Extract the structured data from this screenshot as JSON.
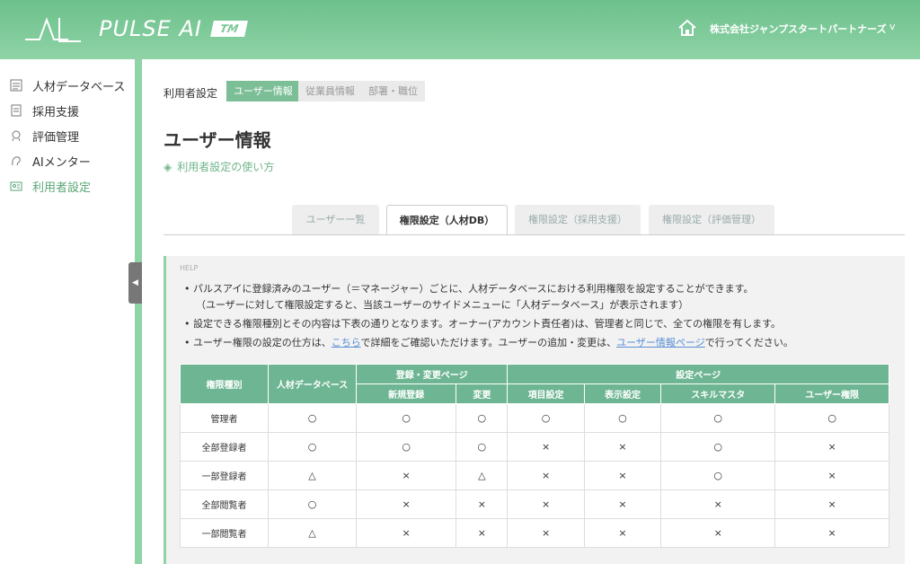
{
  "header": {
    "brand": "PULSE AI",
    "brand_tm": "TM",
    "company": "株式会社ジャンプスタートパートナーズ",
    "company_chevron": "v"
  },
  "sidebar": {
    "items": [
      {
        "label": "人材データベース",
        "icon": "database-icon"
      },
      {
        "label": "採用支援",
        "icon": "document-icon"
      },
      {
        "label": "評価管理",
        "icon": "medal-icon"
      },
      {
        "label": "AIメンター",
        "icon": "mentor-icon"
      },
      {
        "label": "利用者設定",
        "icon": "settings-card-icon",
        "active": true
      }
    ],
    "collapse": "◀"
  },
  "breadcrumb": {
    "label": "利用者設定",
    "tabs": [
      "ユーザー情報",
      "従業員情報",
      "部署・職位"
    ]
  },
  "page": {
    "title": "ユーザー情報",
    "help_link": "利用者設定の使い方"
  },
  "tabs": [
    "ユーザー一覧",
    "権限設定（人材DB）",
    "権限設定（採用支援）",
    "権限設定（評価管理）"
  ],
  "help": {
    "label": "HELP",
    "line1": "パルスアイに登録済みのユーザー（＝マネージャー）ごとに、人材データベースにおける利用権限を設定することができます。",
    "line1b": "（ユーザーに対して権限設定すると、当該ユーザーのサイドメニューに「人材データベース」が表示されます）",
    "line2": "設定できる権限種別とその内容は下表の通りとなります。オーナー(アカウント責任者)は、管理者と同じで、全ての権限を有します。",
    "line3_a": "ユーザー権限の設定の仕方は、",
    "line3_link1": "こちら",
    "line3_b": "で詳細をご確認いただけます。ユーザーの追加・変更は、",
    "line3_link2": "ユーザー情報ページ",
    "line3_c": "で行ってください。"
  },
  "table": {
    "head_type": "権限種別",
    "head_db": "人材データベース",
    "group_register": "登録・変更ページ",
    "group_settings": "設定ページ",
    "sub": [
      "新規登録",
      "変更",
      "項目設定",
      "表示設定",
      "スキルマスタ",
      "ユーザー権限"
    ],
    "rows": [
      {
        "name": "管理者",
        "cells": [
          "○",
          "○",
          "○",
          "○",
          "○",
          "○",
          "○"
        ]
      },
      {
        "name": "全部登録者",
        "cells": [
          "○",
          "○",
          "○",
          "×",
          "×",
          "○",
          "×"
        ]
      },
      {
        "name": "一部登録者",
        "cells": [
          "△",
          "×",
          "△",
          "×",
          "×",
          "○",
          "×"
        ]
      },
      {
        "name": "全部閲覧者",
        "cells": [
          "○",
          "×",
          "×",
          "×",
          "×",
          "×",
          "×"
        ]
      },
      {
        "name": "一部閲覧者",
        "cells": [
          "△",
          "×",
          "×",
          "×",
          "×",
          "×",
          "×"
        ]
      }
    ]
  },
  "colors": {
    "accent": "#6eb693",
    "header": "#7cc796",
    "link": "#5a8fd6"
  }
}
